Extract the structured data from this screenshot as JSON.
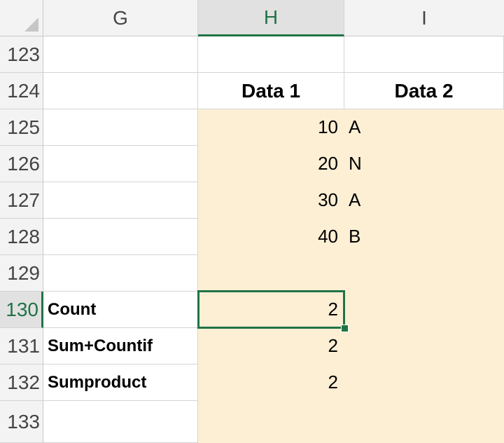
{
  "columns": {
    "g": "G",
    "h": "H",
    "i": "I"
  },
  "rows": [
    "123",
    "124",
    "125",
    "126",
    "127",
    "128",
    "129",
    "130",
    "131",
    "132",
    "133"
  ],
  "selected_column": "H",
  "selected_row": "130",
  "headers": {
    "data1": "Data 1",
    "data2": "Data 2"
  },
  "data": [
    {
      "value": "10",
      "code": "A"
    },
    {
      "value": "20",
      "code": "N"
    },
    {
      "value": "30",
      "code": "A"
    },
    {
      "value": "40",
      "code": "B"
    }
  ],
  "results": [
    {
      "label": "Count",
      "value": "2"
    },
    {
      "label": "Sum+Countif",
      "value": "2"
    },
    {
      "label": "Sumproduct",
      "value": "2"
    }
  ],
  "colors": {
    "fill": "#fdefd4",
    "accent": "#217346"
  }
}
